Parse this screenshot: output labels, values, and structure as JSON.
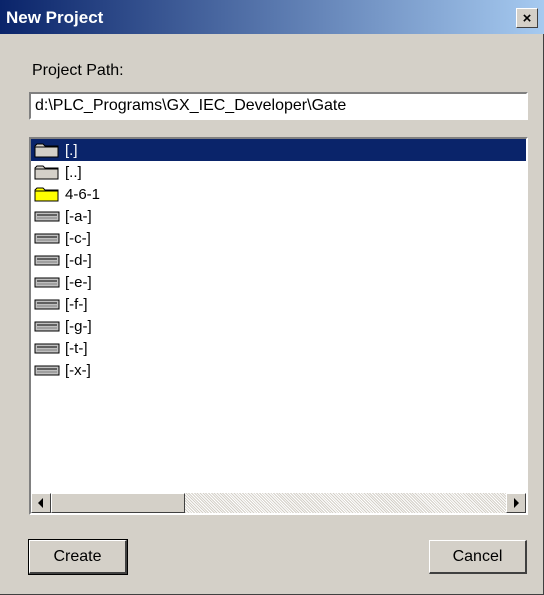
{
  "window": {
    "title": "New Project",
    "close_label": "×"
  },
  "path": {
    "label": "Project Path:",
    "value": "d:\\PLC_Programs\\GX_IEC_Developer\\Gate"
  },
  "list": {
    "items": [
      {
        "label": "[.]",
        "icon": "folder-icon",
        "selected": true
      },
      {
        "label": "[..]",
        "icon": "folder-icon",
        "selected": false
      },
      {
        "label": "4-6-1",
        "icon": "yellow-folder-icon",
        "selected": false
      },
      {
        "label": "[-a-]",
        "icon": "drive-icon",
        "selected": false
      },
      {
        "label": "[-c-]",
        "icon": "drive-icon",
        "selected": false
      },
      {
        "label": "[-d-]",
        "icon": "drive-icon",
        "selected": false
      },
      {
        "label": "[-e-]",
        "icon": "drive-icon",
        "selected": false
      },
      {
        "label": "[-f-]",
        "icon": "drive-icon",
        "selected": false
      },
      {
        "label": "[-g-]",
        "icon": "drive-icon",
        "selected": false
      },
      {
        "label": "[-t-]",
        "icon": "drive-icon",
        "selected": false
      },
      {
        "label": "[-x-]",
        "icon": "drive-icon",
        "selected": false
      }
    ]
  },
  "buttons": {
    "create": "Create",
    "cancel": "Cancel"
  },
  "colors": {
    "titlebar_start": "#0a246a",
    "titlebar_end": "#a6caf0",
    "selection": "#0a246a",
    "face": "#d4d0c8",
    "folder_yellow": "#ffff00"
  }
}
